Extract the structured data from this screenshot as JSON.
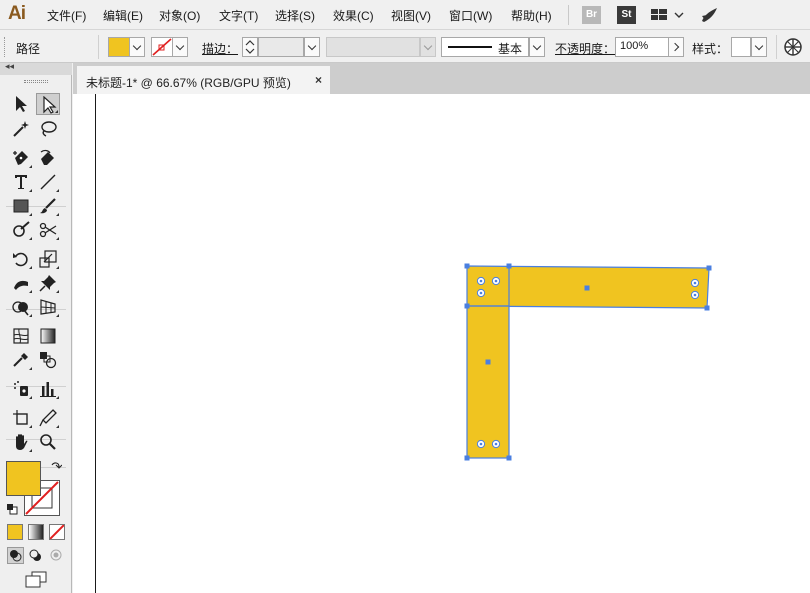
{
  "app": {
    "logo": "Ai"
  },
  "menu": {
    "items": [
      "文件(F)",
      "编辑(E)",
      "对象(O)",
      "文字(T)",
      "选择(S)",
      "效果(C)",
      "视图(V)",
      "窗口(W)",
      "帮助(H)"
    ],
    "bridge": "Br",
    "stock": "St"
  },
  "control": {
    "selection_label": "路径",
    "stroke_label": "描边：",
    "stroke_style": "基本",
    "opacity_label": "不透明度：",
    "opacity_value": "100%",
    "style_label": "样式："
  },
  "document": {
    "tab_title": "未标题-1* @ 66.67% (RGB/GPU 预览)",
    "close_glyph": "×"
  },
  "colors": {
    "fill": "#f0c420",
    "selection": "#4a7fe0",
    "none_slash": "#e02020"
  },
  "tools": [
    "selection-tool",
    "direct-selection-tool",
    "magic-wand-tool",
    "lasso-tool",
    "pen-tool",
    "curvature-tool",
    "type-tool",
    "line-tool",
    "rectangle-tool",
    "paintbrush-tool",
    "shaper-tool",
    "scissors-tool",
    "rotate-tool",
    "scale-tool",
    "width-tool",
    "puppet-warp-tool",
    "shape-builder-tool",
    "perspective-grid-tool",
    "mesh-tool",
    "gradient-tool",
    "eyedropper-tool",
    "blend-tool",
    "symbol-sprayer-tool",
    "column-graph-tool",
    "artboard-tool",
    "slice-tool",
    "hand-tool",
    "zoom-tool"
  ]
}
